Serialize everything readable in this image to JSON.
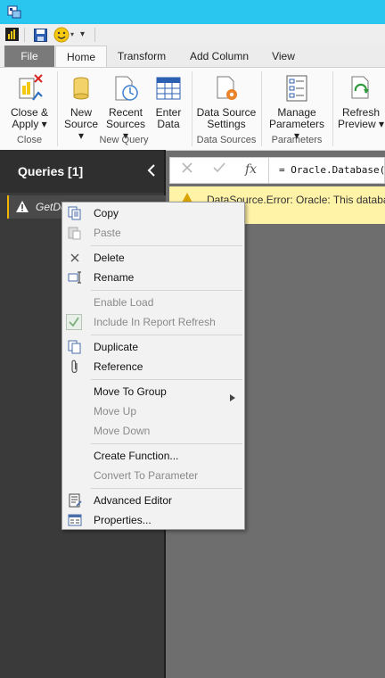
{
  "ribbon": {
    "tabs": [
      "File",
      "Home",
      "Transform",
      "Add Column",
      "View"
    ],
    "buttons": {
      "close_apply": [
        "Close &",
        "Apply ▾"
      ],
      "new_source": [
        "New",
        "Source ▾"
      ],
      "recent_sources": [
        "Recent",
        "Sources ▾"
      ],
      "enter_data": [
        "Enter",
        "Data"
      ],
      "data_source_settings": [
        "Data Source",
        "Settings"
      ],
      "manage_parameters": [
        "Manage",
        "Parameters ▾"
      ],
      "refresh_preview": [
        "Refresh",
        "Preview ▾"
      ]
    },
    "groups": [
      "Close",
      "New Query",
      "Data Sources",
      "Parameters"
    ]
  },
  "queries": {
    "header": "Queries [1]",
    "item": "GetDc"
  },
  "formula": {
    "fx": "fx",
    "text": "= Oracle.Database("
  },
  "error": {
    "text": "DataSource.Error: Oracle: This databas"
  },
  "context_menu": {
    "copy": "Copy",
    "paste": "Paste",
    "delete": "Delete",
    "rename": "Rename",
    "enable_load": "Enable Load",
    "include_refresh": "Include In Report Refresh",
    "duplicate": "Duplicate",
    "reference": "Reference",
    "move_to_group": "Move To Group",
    "move_up": "Move Up",
    "move_down": "Move Down",
    "create_function": "Create Function...",
    "convert_parameter": "Convert To Parameter",
    "advanced_editor": "Advanced Editor",
    "properties": "Properties..."
  },
  "colors": {
    "titlebar": "#2bc6f0",
    "accent_warning": "#f0b400",
    "error_bg": "#fff3a8"
  }
}
